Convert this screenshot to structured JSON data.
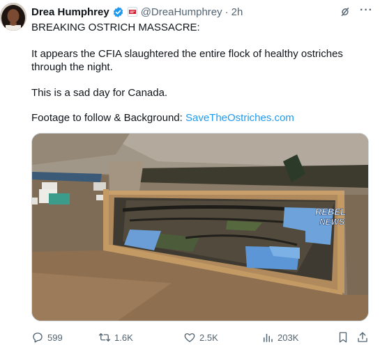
{
  "author": {
    "display_name": "Drea Humphrey",
    "handle": "@DreaHumphrey",
    "separator": "·",
    "time": "2h",
    "verified_icon": "verified-badge-icon",
    "affiliation_icon": "affiliate-badge-icon"
  },
  "post": {
    "line1": "BREAKING OSTRICH MASSACRE:",
    "line2": "It appears the CFIA slaughtered the entire flock of healthy ostriches through the night.",
    "line3": "This is a sad day for Canada.",
    "line4_prefix": "Footage to follow & Background: ",
    "link_text": "SaveTheOstriches.com"
  },
  "media": {
    "watermark_line1": "REBEL",
    "watermark_line2": "NEWS"
  },
  "metrics": {
    "replies": "599",
    "reposts": "1.6K",
    "likes": "2.5K",
    "views": "203K"
  },
  "colors": {
    "accent": "#1d9bf0",
    "muted": "#536471",
    "text": "#0f1419"
  }
}
